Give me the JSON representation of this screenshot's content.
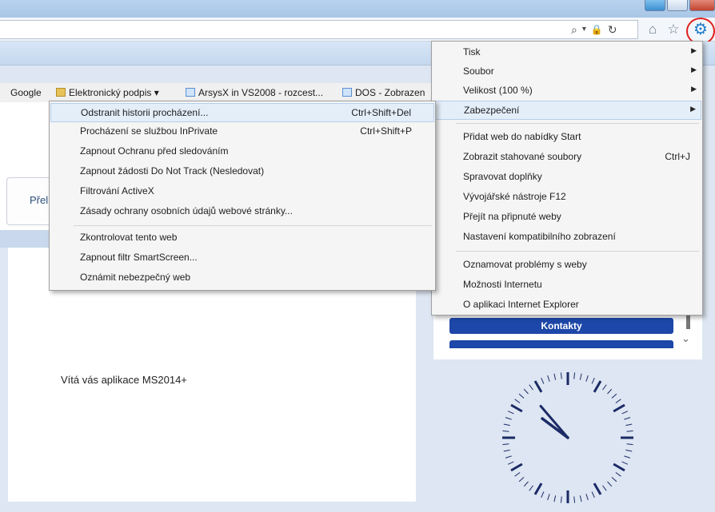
{
  "browser": {
    "address_icons": [
      "⌕",
      "▾",
      "🔒",
      "↻"
    ],
    "favorites": [
      {
        "label": "Google",
        "icon": "none"
      },
      {
        "label": "Elektronický podpis ▾",
        "icon": "folder-icon"
      },
      {
        "label": "ArsysX in VS2008 - rozcest...",
        "icon": "page-icon"
      },
      {
        "label": "DOS - Zobrazen",
        "icon": "page-icon"
      }
    ]
  },
  "page": {
    "nav_tab_label": "Přel",
    "welcome_text": "Vítá vás aplikace MS2014+",
    "kontakty_label": "Kontakty"
  },
  "tools_menu": {
    "items": [
      {
        "label": "Tisk",
        "submenu": true
      },
      {
        "label": "Soubor",
        "submenu": true
      },
      {
        "label": "Velikost (100 %)",
        "submenu": true
      },
      {
        "label": "Zabezpečení",
        "submenu": true,
        "highlighted": true
      },
      {
        "label": "Přidat web do nabídky Start"
      },
      {
        "label": "Zobrazit stahované soubory",
        "shortcut": "Ctrl+J"
      },
      {
        "label": "Spravovat doplňky"
      },
      {
        "label": "Vývojářské nástroje F12"
      },
      {
        "label": "Přejít na připnuté weby"
      },
      {
        "label": "Nastavení kompatibilního zobrazení"
      },
      {
        "label": "Oznamovat problémy s weby"
      },
      {
        "label": "Možnosti Internetu"
      },
      {
        "label": "O aplikaci Internet Explorer"
      }
    ]
  },
  "security_menu": {
    "items": [
      {
        "label": "Odstranit historii procházení...",
        "shortcut": "Ctrl+Shift+Del",
        "highlighted": true
      },
      {
        "label": "Procházení se službou InPrivate",
        "shortcut": "Ctrl+Shift+P"
      },
      {
        "label": "Zapnout Ochranu před sledováním"
      },
      {
        "label": "Zapnout žádosti Do Not Track (Nesledovat)"
      },
      {
        "label": "Filtrování ActiveX"
      },
      {
        "label": "Zásady ochrany osobních údajů webové stránky..."
      },
      {
        "label": "Zkontrolovat tento web"
      },
      {
        "label": "Zapnout filtr SmartScreen..."
      },
      {
        "label": "Oznámit nebezpečný web"
      }
    ]
  },
  "colors": {
    "accent": "#1d47a8",
    "highlight": "#e4eef9",
    "annotation": "#e0201e"
  }
}
